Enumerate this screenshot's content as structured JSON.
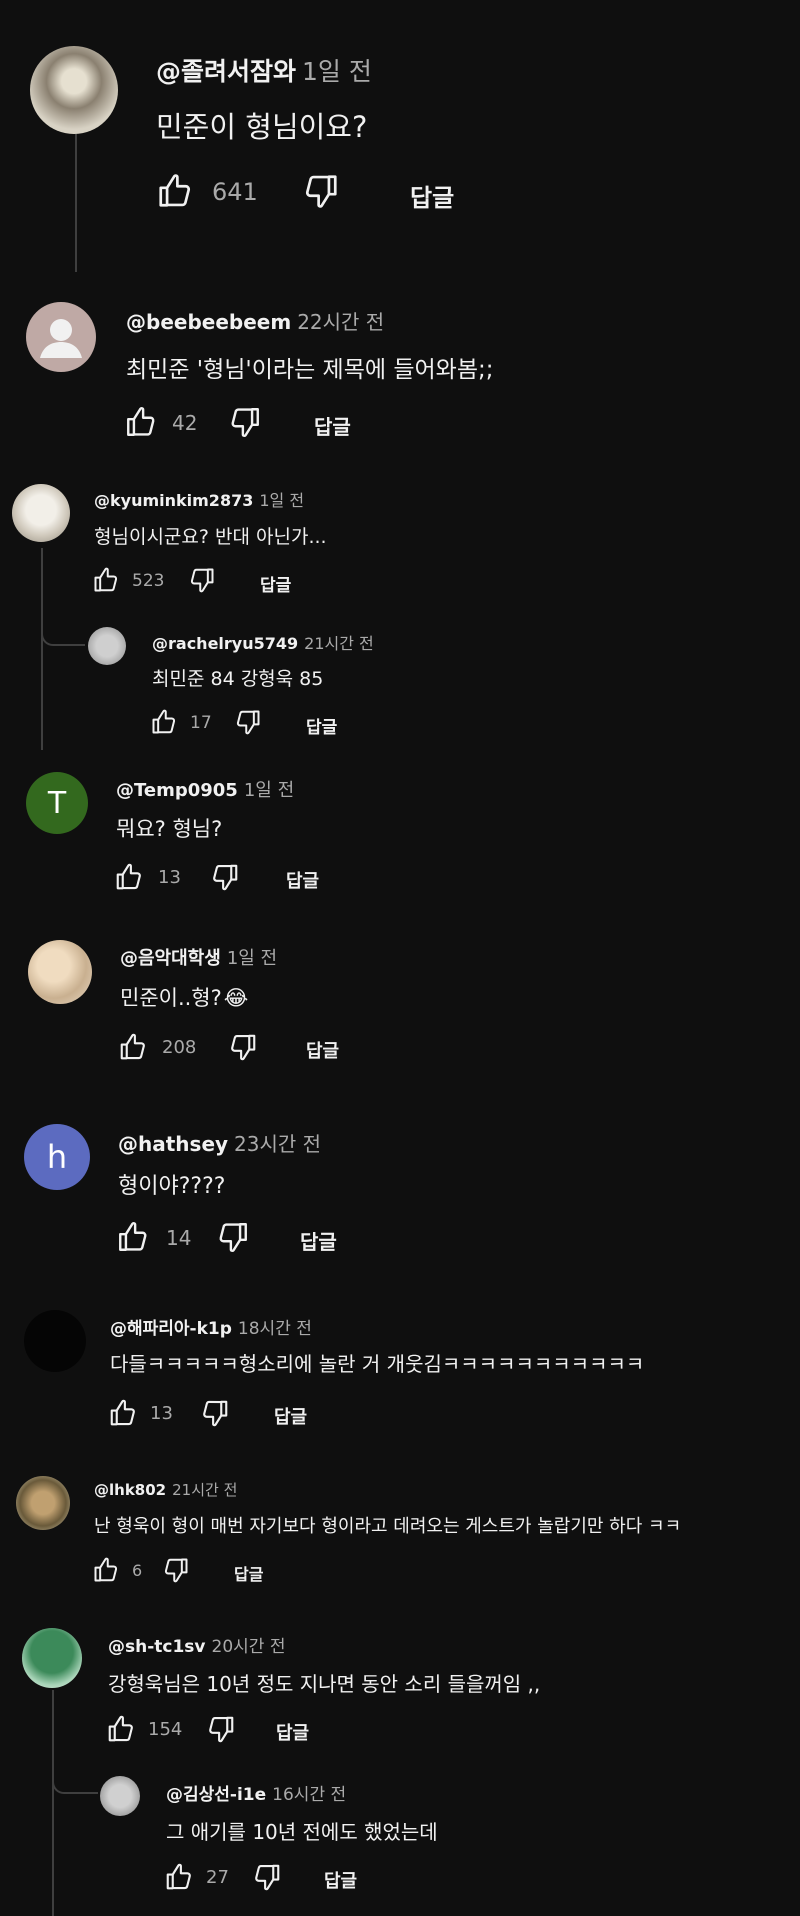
{
  "labels": {
    "reply": "답글"
  },
  "comments": [
    {
      "handle": "@졸려서잠와",
      "time": "1일 전",
      "text": "민준이 형님이요?",
      "likes": "641"
    },
    {
      "handle": "@beebeebeem",
      "time": "22시간 전",
      "text": "최민준 '형님'이라는 제목에 들어와봄;;",
      "likes": "42"
    },
    {
      "handle": "@kyuminkim2873",
      "time": "1일 전",
      "text": "형님이시군요? 반대 아닌가...",
      "likes": "523"
    },
    {
      "handle": "@rachelryu5749",
      "time": "21시간 전",
      "text": "최민준 84 강형욱 85",
      "likes": "17"
    },
    {
      "handle": "@Temp0905",
      "time": "1일 전",
      "text": "뭐요? 형님?",
      "likes": "13",
      "avatar_letter": "T"
    },
    {
      "handle": "@음악대학생",
      "time": "1일 전",
      "text": "민준이..형?",
      "emoji": "😂",
      "likes": "208"
    },
    {
      "handle": "@hathsey",
      "time": "23시간 전",
      "text": "형이야????",
      "likes": "14",
      "avatar_letter": "h"
    },
    {
      "handle": "@해파리아-k1p",
      "time": "18시간 전",
      "text": "다들ㅋㅋㅋㅋㅋ형소리에 놀란 거 개웃김ㅋㅋㅋㅋㅋㅋㅋㅋㅋㅋㅋ",
      "likes": "13"
    },
    {
      "handle": "@lhk802",
      "time": "21시간 전",
      "text": "난 형욱이 형이 매번 자기보다 형이라고 데려오는 게스트가 놀랍기만 하다 ㅋㅋ",
      "likes": "6"
    },
    {
      "handle": "@sh-tc1sv",
      "time": "20시간 전",
      "text": "강형욱님은 10년 정도 지나면 동안 소리 들을꺼임 ,,",
      "likes": "154"
    },
    {
      "handle": "@김상선-i1e",
      "time": "16시간 전",
      "text": "그 애기를 10년 전에도 했었는데",
      "likes": "27"
    }
  ],
  "colors": {
    "bg": "#0f0f0f",
    "temp_avatar": "#33691e",
    "hathsey_avatar": "#5c6bc0"
  }
}
